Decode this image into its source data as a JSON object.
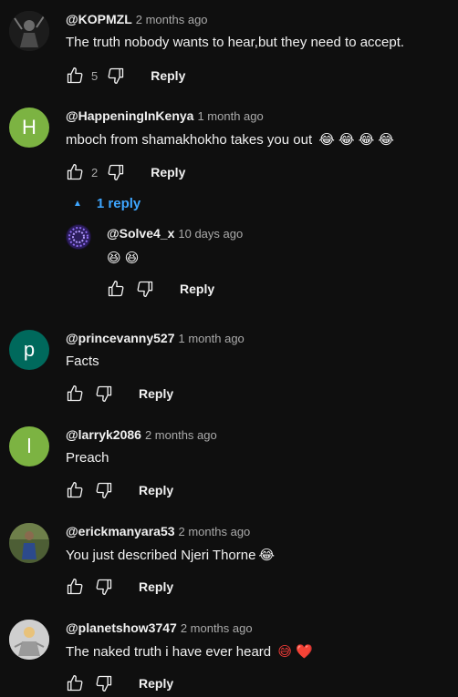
{
  "comments": [
    {
      "author": "@KOPMZL",
      "time": "2 months ago",
      "text": "The truth nobody wants to hear,but they need to accept.",
      "likes": "5",
      "reply_label": "Reply"
    },
    {
      "author": "@HappeningInKenya",
      "time": "1 month ago",
      "text": "mboch from shamakhokho takes you out",
      "emoji": "😂 😂 😂 😂",
      "likes": "2",
      "reply_label": "Reply",
      "avatar_letter": "H",
      "avatar_color": "#7cb342"
    },
    {
      "author": "@princevanny527",
      "time": "1 month ago",
      "text": "Facts",
      "reply_label": "Reply",
      "avatar_letter": "p",
      "avatar_color": "#00695c"
    },
    {
      "author": "@larryk2086",
      "time": "2 months ago",
      "text": "Preach",
      "reply_label": "Reply",
      "avatar_letter": "l",
      "avatar_color": "#7cb342"
    },
    {
      "author": "@erickmanyara53",
      "time": "2 months ago",
      "text": "You just described Njeri Thorne",
      "emoji": "😂",
      "reply_label": "Reply"
    },
    {
      "author": "@planetshow3747",
      "time": "2 months ago",
      "text": "The naked truth i have ever heard",
      "emoji": "😅 ❤️",
      "reply_label": "Reply"
    }
  ],
  "replies_toggle": {
    "label": "1 reply",
    "icon": "caret-up-icon"
  },
  "reply": {
    "author": "@Solve4_x",
    "time": "10 days ago",
    "text": "😆 😆",
    "reply_label": "Reply"
  },
  "colors": {
    "accent": "#3ea6ff",
    "background": "#0f0f0f",
    "secondary_text": "#aaaaaa"
  }
}
